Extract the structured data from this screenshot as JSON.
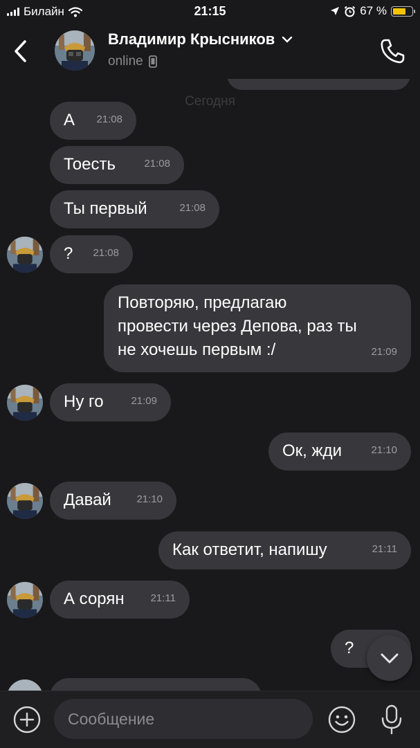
{
  "status_bar": {
    "carrier": "Билайн",
    "time": "21:15",
    "battery_percent": "67 %",
    "battery_level": 0.67,
    "battery_color": "#f5c400"
  },
  "header": {
    "contact_name": "Владимир Крысников",
    "presence": "online",
    "icons": [
      "back-chevron-icon",
      "chevron-down-icon",
      "phone-icon",
      "mobile-device-icon"
    ]
  },
  "chat": {
    "date_separator": "Сегодня",
    "messages": [
      {
        "side": "in",
        "text": "А",
        "time": "21:08"
      },
      {
        "side": "in",
        "text": "Тоесть",
        "time": "21:08"
      },
      {
        "side": "in",
        "text": "Ты первый",
        "time": "21:08"
      },
      {
        "side": "in",
        "text": "?",
        "time": "21:08"
      },
      {
        "side": "out",
        "text": "Повторяю, предлагаю\nпровести через Депова, раз ты\nне хочешь первым :/",
        "time": "21:09"
      },
      {
        "side": "in",
        "text": "Ну го",
        "time": "21:09"
      },
      {
        "side": "out",
        "text": "Ок, жди",
        "time": "21:10"
      },
      {
        "side": "in",
        "text": "Давай",
        "time": "21:10"
      },
      {
        "side": "out",
        "text": "Как ответит, напишу",
        "time": "21:11"
      },
      {
        "side": "in",
        "text": "А сорян",
        "time": "21:11"
      },
      {
        "side": "out",
        "text": "?",
        "time": ""
      }
    ]
  },
  "composer": {
    "placeholder": "Сообщение",
    "icons": [
      "plus-icon",
      "emoji-icon",
      "microphone-icon",
      "scroll-down-icon"
    ]
  },
  "colors": {
    "background": "#19191b",
    "bubble": "#38383c",
    "secondary_text": "#8a8a8e"
  }
}
